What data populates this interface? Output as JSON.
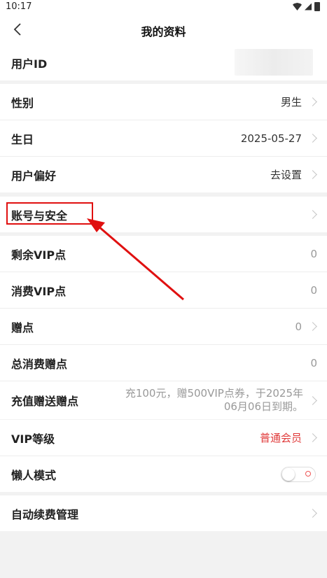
{
  "status": {
    "time": "10:17"
  },
  "nav": {
    "title": "我的资料"
  },
  "sections": {
    "user_id_label": "用户ID",
    "gender": {
      "label": "性别",
      "value": "男生"
    },
    "birthday": {
      "label": "生日",
      "value": "2025-05-27"
    },
    "prefs": {
      "label": "用户偏好",
      "value": "去设置"
    },
    "account": {
      "label": "账号与安全"
    },
    "vip_left": {
      "label": "剩余VIP点",
      "value": "0"
    },
    "vip_used": {
      "label": "消费VIP点",
      "value": "0"
    },
    "gift": {
      "label": "赠点",
      "value": "0"
    },
    "gift_used": {
      "label": "总消费赠点",
      "value": "0"
    },
    "recharge": {
      "label": "充值赠送赠点",
      "line1": "充100元，赠500VIP点券，于2025年",
      "line2": "06月06日到期。"
    },
    "vip_level": {
      "label": "VIP等级",
      "value": "普通会员"
    },
    "lazy": {
      "label": "懒人模式"
    },
    "auto_renew": {
      "label": "自动续费管理"
    }
  },
  "colors": {
    "accent_red": "#e03a3a",
    "annotation_red": "#e01010"
  },
  "icons": [
    "back-arrow-icon",
    "chevron-right-icon",
    "wifi-icon",
    "signal-icon",
    "battery-icon"
  ]
}
